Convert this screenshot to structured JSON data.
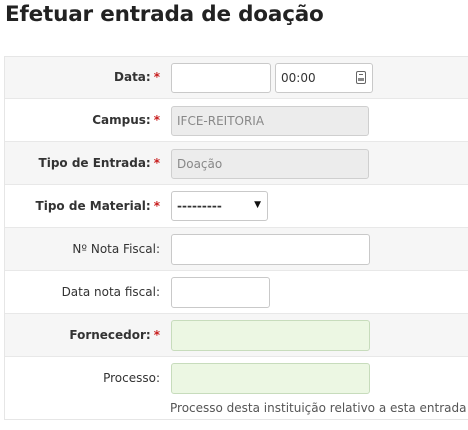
{
  "page": {
    "title": "Efetuar entrada de doação"
  },
  "form": {
    "data": {
      "label": "Data:",
      "date_value": "",
      "time_value": "00:00"
    },
    "campus": {
      "label": "Campus:",
      "value": "IFCE-REITORIA"
    },
    "tipo_entrada": {
      "label": "Tipo de Entrada:",
      "value": "Doação"
    },
    "tipo_material": {
      "label": "Tipo de Material:",
      "selected": "---------"
    },
    "nota_fiscal": {
      "label": "Nº Nota Fiscal:",
      "value": ""
    },
    "data_nota": {
      "label": "Data nota fiscal:",
      "value": ""
    },
    "fornecedor": {
      "label": "Fornecedor:",
      "value": ""
    },
    "processo": {
      "label": "Processo:",
      "value": "",
      "help": "Processo desta instituição relativo a esta entrada"
    },
    "required_mark": "*"
  },
  "colors": {
    "required": "#c81e1e",
    "autocomplete_bg": "#ecf7e3",
    "disabled_bg": "#ececec"
  }
}
